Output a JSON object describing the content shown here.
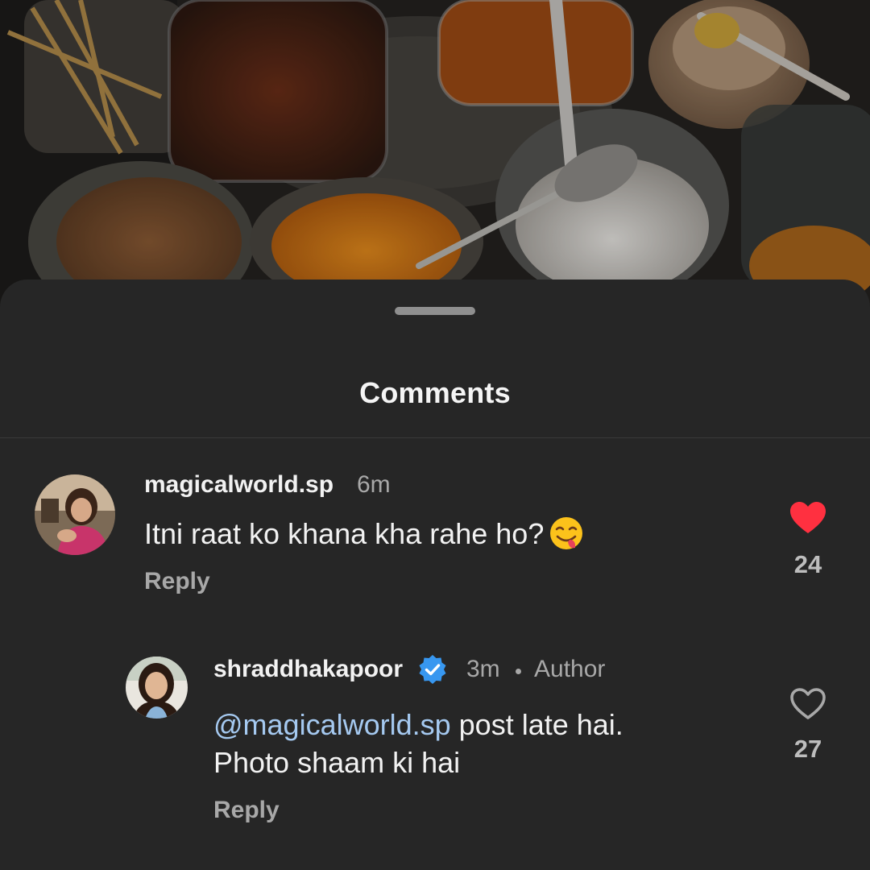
{
  "sheet": {
    "title": "Comments"
  },
  "comments": [
    {
      "username": "magicalworld.sp",
      "time": "6m",
      "text": "Itni raat ko khana kha rahe ho?",
      "emoji": "face-savoring-food",
      "reply_label": "Reply",
      "likes": "24",
      "liked": true
    }
  ],
  "replies": [
    {
      "username": "shraddhakapoor",
      "verified": true,
      "time": "3m",
      "badge": "Author",
      "mention": "@magicalworld.sp",
      "text_line1": " post late hai.",
      "text_line2": "Photo shaam ki hai",
      "reply_label": "Reply",
      "likes": "27",
      "liked": false
    }
  ],
  "colors": {
    "sheet_bg": "#262626",
    "like_active": "#ff3040",
    "verified": "#3797f0",
    "mention": "#a5c9f0"
  }
}
